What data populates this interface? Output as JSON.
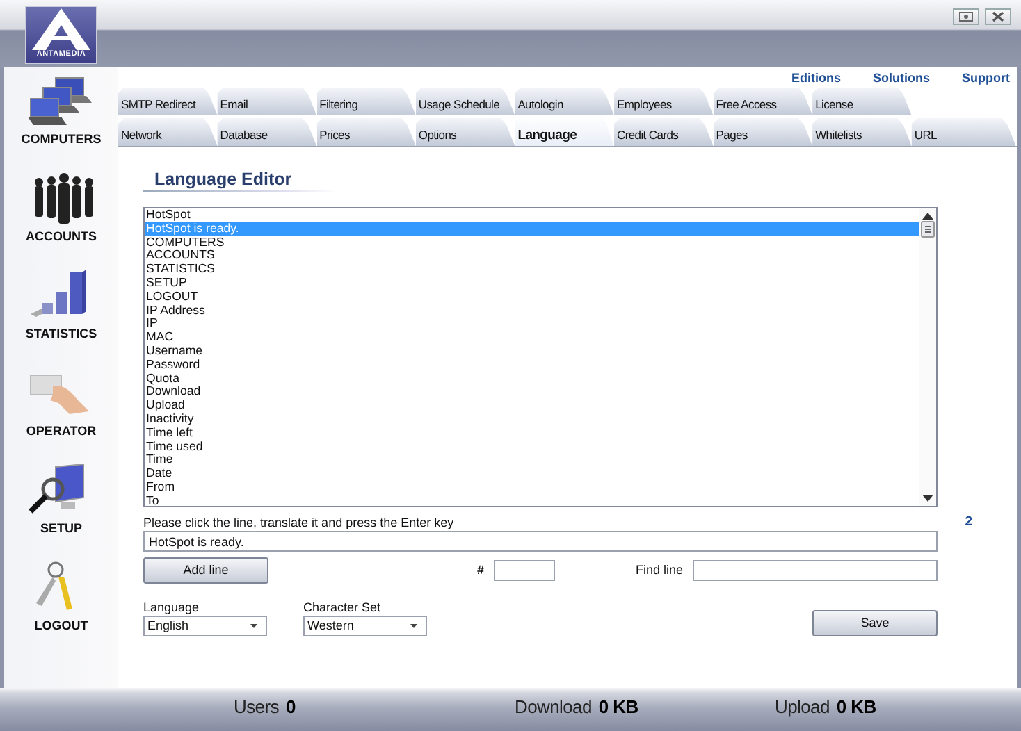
{
  "logo": {
    "text": "ANTAMEDIA"
  },
  "sidebar": {
    "items": [
      {
        "label": "COMPUTERS",
        "kind": "computers"
      },
      {
        "label": "ACCOUNTS",
        "kind": "accounts"
      },
      {
        "label": "STATISTICS",
        "kind": "statistics"
      },
      {
        "label": "OPERATOR",
        "kind": "operator"
      },
      {
        "label": "SETUP",
        "kind": "setup"
      },
      {
        "label": "LOGOUT",
        "kind": "logout"
      }
    ]
  },
  "links": [
    "Editions",
    "Solutions",
    "Support"
  ],
  "tabs": {
    "rows": [
      [
        {
          "label": "SMTP Redirect",
          "selected": false
        },
        {
          "label": "Email",
          "selected": false
        },
        {
          "label": "Filtering",
          "selected": false
        },
        {
          "label": "Usage Schedule",
          "selected": false
        },
        {
          "label": "Autologin",
          "selected": false
        },
        {
          "label": "Employees",
          "selected": false
        },
        {
          "label": "Free Access",
          "selected": false
        },
        {
          "label": "License",
          "selected": false
        }
      ],
      [
        {
          "label": "Network",
          "selected": false
        },
        {
          "label": "Database",
          "selected": false
        },
        {
          "label": "Prices",
          "selected": false
        },
        {
          "label": "Options",
          "selected": false
        },
        {
          "label": "Language",
          "selected": true
        },
        {
          "label": "Credit Cards",
          "selected": false
        },
        {
          "label": "Pages",
          "selected": false
        },
        {
          "label": "Whitelists",
          "selected": false
        },
        {
          "label": "URL",
          "selected": false
        }
      ]
    ]
  },
  "editor": {
    "title": "Language Editor",
    "lines": [
      {
        "text": "HotSpot",
        "selected": false
      },
      {
        "text": "HotSpot is ready.",
        "selected": true
      },
      {
        "text": "COMPUTERS",
        "selected": false
      },
      {
        "text": "ACCOUNTS",
        "selected": false
      },
      {
        "text": "STATISTICS",
        "selected": false
      },
      {
        "text": "SETUP",
        "selected": false
      },
      {
        "text": "LOGOUT",
        "selected": false
      },
      {
        "text": "IP Address",
        "selected": false
      },
      {
        "text": "IP",
        "selected": false
      },
      {
        "text": "MAC",
        "selected": false
      },
      {
        "text": "Username",
        "selected": false
      },
      {
        "text": "Password",
        "selected": false
      },
      {
        "text": "Quota",
        "selected": false
      },
      {
        "text": "Download",
        "selected": false
      },
      {
        "text": "Upload",
        "selected": false
      },
      {
        "text": "Inactivity",
        "selected": false
      },
      {
        "text": "Time left",
        "selected": false
      },
      {
        "text": "Time used",
        "selected": false
      },
      {
        "text": "Time",
        "selected": false
      },
      {
        "text": "Date",
        "selected": false
      },
      {
        "text": "From",
        "selected": false
      },
      {
        "text": "To",
        "selected": false
      }
    ],
    "hint": "Please click the line, translate it and press the Enter key",
    "line_number": "2",
    "edit_value": "HotSpot is ready.",
    "add_button": "Add line",
    "number_label": "#",
    "find_label": "Find line",
    "language": {
      "label": "Language",
      "value": "English"
    },
    "charset": {
      "label": "Character Set",
      "value": "Western"
    },
    "save_button": "Save"
  },
  "status_bar": [
    {
      "label": "Users",
      "value": "0"
    },
    {
      "label": "Download",
      "value": "0 KB"
    },
    {
      "label": "Upload",
      "value": "0 KB"
    }
  ]
}
